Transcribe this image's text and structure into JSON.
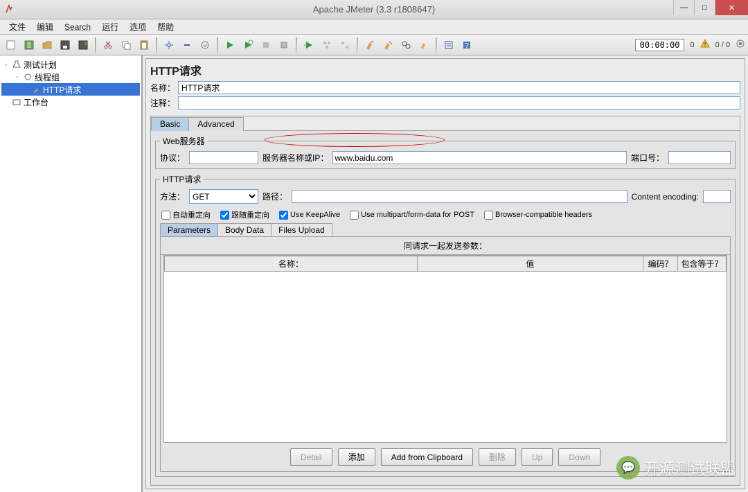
{
  "window": {
    "title": "Apache JMeter (3.3 r1808647)"
  },
  "menu": {
    "file": "文件",
    "edit": "编辑",
    "search": "Search",
    "run": "运行",
    "options": "选项",
    "help": "帮助"
  },
  "toolbar": {
    "timer": "00:00:00",
    "counter1": "0",
    "counter2": "0 / 0"
  },
  "tree": {
    "test_plan": "测试计划",
    "thread_group": "线程组",
    "http_request": "HTTP请求",
    "workbench": "工作台"
  },
  "panel": {
    "title": "HTTP请求",
    "name_label": "名称：",
    "name_value": "HTTP请求",
    "comment_label": "注释：",
    "comment_value": "",
    "tab_basic": "Basic",
    "tab_advanced": "Advanced"
  },
  "webserver": {
    "legend": "Web服务器",
    "protocol_label": "协议：",
    "protocol_value": "",
    "server_label": "服务器名称或IP：",
    "server_value": "www.baidu.com",
    "port_label": "端口号：",
    "port_value": ""
  },
  "httpreq": {
    "legend": "HTTP请求",
    "method_label": "方法：",
    "method_value": "GET",
    "path_label": "路径：",
    "path_value": "",
    "encoding_label": "Content encoding:",
    "encoding_value": ""
  },
  "checkboxes": {
    "auto_redirect": "自动重定向",
    "follow_redirect": "跟随重定向",
    "keepalive": "Use KeepAlive",
    "multipart": "Use multipart/form-data for POST",
    "browser_compat": "Browser-compatible headers"
  },
  "subtabs": {
    "parameters": "Parameters",
    "body_data": "Body Data",
    "files_upload": "Files Upload"
  },
  "params": {
    "header": "同请求一起发送参数：",
    "col_name": "名称：",
    "col_value": "值",
    "col_encode": "编码？",
    "col_include": "包含等于？"
  },
  "buttons": {
    "detail": "Detail",
    "add": "添加",
    "clipboard": "Add from Clipboard",
    "delete": "删除",
    "up": "Up",
    "down": "Down"
  },
  "watermark": {
    "text": "开源测试联盟"
  }
}
